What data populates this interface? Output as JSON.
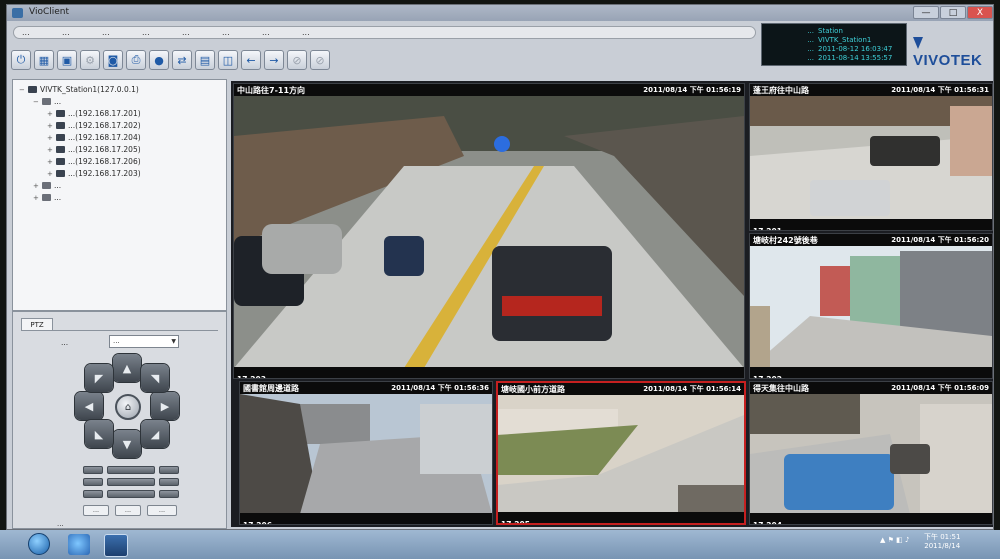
{
  "window": {
    "title": "VioClient"
  },
  "win_controls": {
    "minimize": "—",
    "maximize": "□",
    "close": "X"
  },
  "menu": [
    "...",
    "...",
    "...",
    "...",
    "...",
    "...",
    "...",
    "..."
  ],
  "toolbar": {
    "buttons": [
      "power-icon",
      "layout-icon",
      "lock-icon",
      "settings-icon",
      "camera-icon",
      "print-icon",
      "record-icon",
      "switch-icon",
      "grid-icon",
      "layout-4-icon",
      "arrow-left-icon",
      "arrow-right-icon",
      "disabled-icon",
      "disabled-icon-2"
    ]
  },
  "info": {
    "rows": [
      {
        "label": "...",
        "value": "Station"
      },
      {
        "label": "...",
        "value": "VIVTK_Station1"
      },
      {
        "label": "...",
        "value": "2011-08-12 16:03:47"
      },
      {
        "label": "...",
        "value": "2011-08-14 13:55:57"
      }
    ]
  },
  "logo": {
    "text": "VIVOTEK"
  },
  "tree": {
    "root": "VIVTK_Station1(127.0.0.1)",
    "group": "...",
    "cameras": [
      "...(192.168.17.201)",
      "...(192.168.17.202)",
      "...(192.168.17.204)",
      "...(192.168.17.205)",
      "...(192.168.17.206)",
      "...(192.168.17.203)"
    ],
    "other1": "...",
    "other2": "..."
  },
  "ptz": {
    "tab": "PTZ",
    "mode_label": "...",
    "mode_value": "...",
    "preset_label": "...",
    "buttons": [
      "...",
      "...",
      "..."
    ]
  },
  "cameras": [
    {
      "name": "中山路往7-11方向",
      "time": "2011/08/14 下午 01:56:19",
      "id": "17.203"
    },
    {
      "name": "蓬王府往中山路",
      "time": "2011/08/14 下午 01:56:31",
      "id": "17.201"
    },
    {
      "name": "塘岐村242號後巷",
      "time": "2011/08/14 下午 01:56:20",
      "id": "17.202"
    },
    {
      "name": "國書館周邊道路",
      "time": "2011/08/14 下午 01:56:36",
      "id": "17.206"
    },
    {
      "name": "塘岐國小前方道路",
      "time": "2011/08/14 下午 01:56:14",
      "id": "17.205"
    },
    {
      "name": "得天集往中山路",
      "time": "2011/08/14 下午 01:56:09",
      "id": "17.204"
    }
  ],
  "clock": {
    "time": "下午 01:51",
    "date": "2011/8/14"
  },
  "colors": {
    "active_border": "#c62020",
    "logo": "#1e4e9a",
    "info_text": "#3fd0d8"
  }
}
